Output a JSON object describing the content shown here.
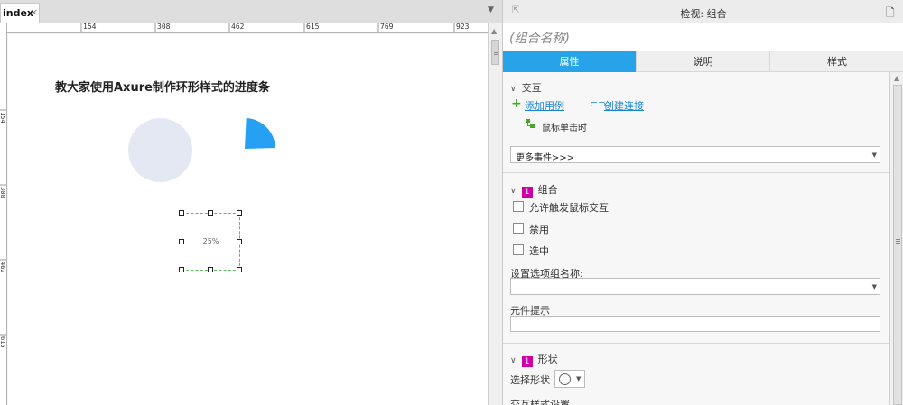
{
  "editor": {
    "tab_label": "index",
    "tab_close": "×",
    "tab_menu": "▼",
    "ruler_h": [
      "154",
      "308",
      "462",
      "615",
      "769",
      "923"
    ],
    "ruler_v": [
      "154",
      "308",
      "462",
      "615"
    ],
    "canvas": {
      "heading": "教大家使用Axure制作环形样式的进度条",
      "progress_label": "25%",
      "progress_value": 0.25
    }
  },
  "inspector": {
    "title": "检视: 组合",
    "widget_name_placeholder": "(组合名称)",
    "tabs": [
      "属性",
      "说明",
      "样式"
    ],
    "active_tab": "属性",
    "interaction": {
      "section_label": "交互",
      "add_case": "添加用例",
      "create_link": "创建连接",
      "event": "鼠标单击时",
      "more_events": "更多事件>>>"
    },
    "group": {
      "badge": "1",
      "section_label": "组合",
      "checkboxes": [
        {
          "label": "允许触发鼠标交互",
          "checked": false
        },
        {
          "label": "禁用",
          "checked": false
        },
        {
          "label": "选中",
          "checked": false
        }
      ],
      "option_group_label": "设置选项组名称:",
      "option_group_value": "",
      "tooltip_label": "元件提示",
      "tooltip_value": ""
    },
    "shape": {
      "badge": "1",
      "section_label": "形状",
      "select_shape_label": "选择形状",
      "interaction_style_label": "交互样式设置"
    }
  },
  "colors": {
    "accent_tab": "#27a3ea",
    "progress_arc": "#26a0f2",
    "progress_track": "#e3e8f2",
    "badge": "#cc00a4",
    "link": "#1a86d0",
    "add_icon": "#4aa52e"
  }
}
